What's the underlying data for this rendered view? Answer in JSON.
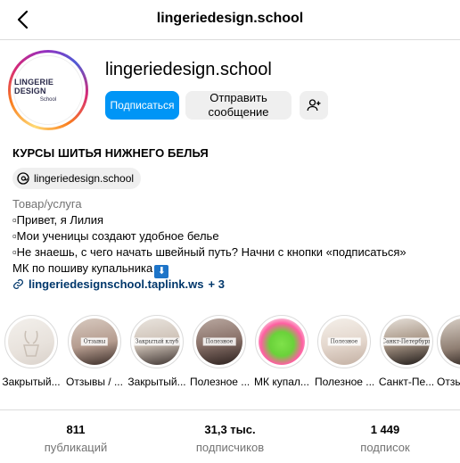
{
  "header": {
    "title": "lingeriedesign.school"
  },
  "profile": {
    "avatar_line1": "LINGERIE DESIGN",
    "avatar_line2": "School",
    "username": "lingeriedesign.school",
    "follow_label": "Подписаться",
    "message_label": "Отправить сообщение",
    "add_user_icon": "add-person-icon"
  },
  "bio": {
    "name": "КУРСЫ ШИТЬЯ НИЖНЕГО БЕЛЬЯ",
    "threads_handle": "lingeriedesign.school",
    "category": "Товар/услуга",
    "lines": [
      "▫Привет, я Лилия",
      "▫Мои ученицы создают удобное белье",
      "▫Не знаешь, с чего начать швейный путь? Начни с кнопки «подписаться»",
      "МК по пошиву купальника"
    ],
    "arrow_emoji": "⬇",
    "link": "lingeriedesignschool.taplink.ws",
    "link_more": "+ 3"
  },
  "highlights": [
    {
      "label": "Закрытый...",
      "tag": ""
    },
    {
      "label": "Отзывы / ...",
      "tag": "Отзывы"
    },
    {
      "label": "Закрытый...",
      "tag": "Закрытый клуб"
    },
    {
      "label": "Полезное ...",
      "tag": "Полезное"
    },
    {
      "label": "МК купал...",
      "tag": ""
    },
    {
      "label": "Полезное ...",
      "tag": "Полезное"
    },
    {
      "label": "Санкт-Пе...",
      "tag": "Санкт-Петербург"
    },
    {
      "label": "Отзывы",
      "tag": ""
    }
  ],
  "stats": [
    {
      "value": "811",
      "label": "публикаций"
    },
    {
      "value": "31,3 тыс.",
      "label": "подписчиков"
    },
    {
      "value": "1 449",
      "label": "подписок"
    }
  ],
  "colors": {
    "accent": "#0095f6",
    "link": "#00376b",
    "muted": "#737373",
    "emoji_box": "#1d74c8"
  }
}
